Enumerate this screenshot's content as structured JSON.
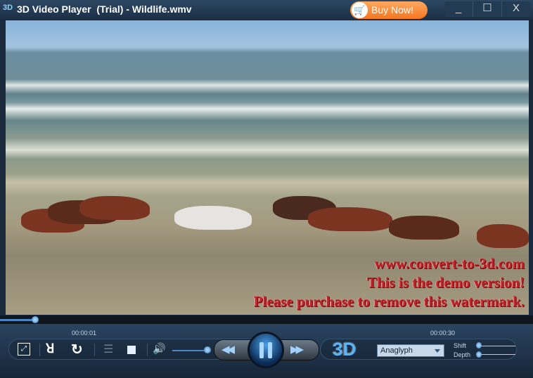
{
  "titlebar": {
    "logo": "3D",
    "title": "3D Video Player  (Trial) - Wildlife.wmv",
    "buy_now": "Buy Now!",
    "minimize": "_",
    "maximize": "☐",
    "close": "X"
  },
  "video": {
    "watermark": [
      "www.convert-to-3d.com",
      "This is the demo version!",
      "Please purchase to remove this watermark."
    ]
  },
  "playback": {
    "current_time": "00:00:01",
    "total_time": "00:00:30",
    "progress_fraction": 0.033,
    "volume_fraction": 1.0
  },
  "controls": {
    "mode_logo": "3D",
    "mode_select": "Anaglyph",
    "shift_label": "Shift",
    "depth_label": "Depth",
    "shift_value": 0,
    "depth_value": 0
  },
  "icons": {
    "fullscreen": "⛶",
    "rewind": "◀◀",
    "forward": "▶▶",
    "volume": "🔊",
    "stop": "■",
    "playlist": "☰"
  }
}
